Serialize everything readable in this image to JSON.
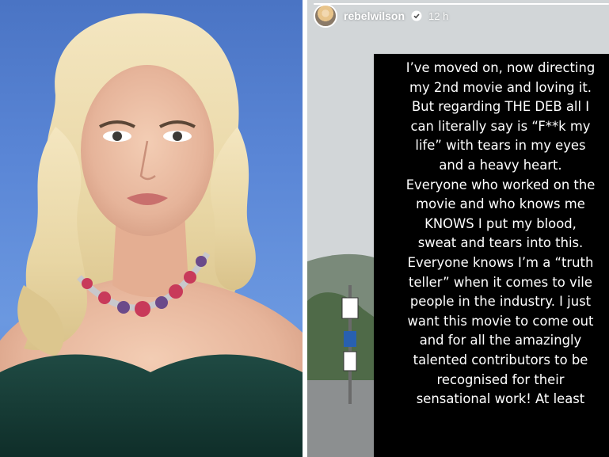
{
  "story": {
    "username": "rebelwilson",
    "time_ago": "12 h",
    "progress": 1.0,
    "verified": true,
    "text_lines": [
      "I’ve moved on, now directing",
      "my 2nd movie and loving it.",
      "But regarding THE DEB all I",
      "can literally say is “F**k my",
      "life” with tears in my eyes",
      "and a heavy heart.",
      "Everyone who worked on the",
      "movie and who knows me",
      "KNOWS I put my blood,",
      "sweat and tears into this.",
      "Everyone knows I’m a “truth",
      "teller” when it comes to vile",
      "people in the industry. I just",
      "want this movie to come out",
      "and for all the amazingly",
      "talented contributors to be",
      "recognised for their",
      "sensational work! At least"
    ],
    "background_colors": {
      "sky": "#d2d6d8",
      "text_box": "#000000"
    }
  },
  "photo": {
    "backdrop_color": "#5a86d6",
    "dress_color": "#173c36",
    "hair_color": "#ecdcae"
  }
}
